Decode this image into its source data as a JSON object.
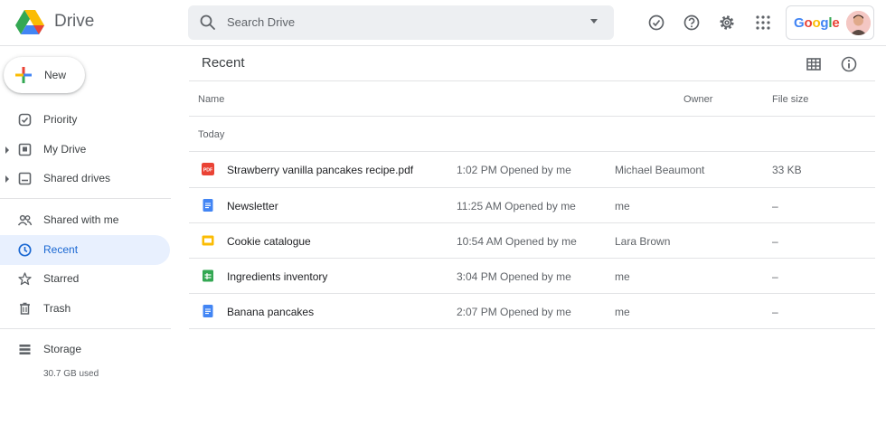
{
  "header": {
    "brand": "Drive",
    "search_placeholder": "Search Drive",
    "account_word": "Google"
  },
  "sidebar": {
    "new_label": "New",
    "items": [
      {
        "label": "Priority",
        "icon": "priority-icon"
      },
      {
        "label": "My Drive",
        "icon": "my-drive-icon"
      },
      {
        "label": "Shared drives",
        "icon": "shared-drives-icon"
      },
      {
        "label": "Shared with me",
        "icon": "shared-with-me-icon"
      },
      {
        "label": "Recent",
        "icon": "clock-icon"
      },
      {
        "label": "Starred",
        "icon": "star-icon"
      },
      {
        "label": "Trash",
        "icon": "trash-icon"
      },
      {
        "label": "Storage",
        "icon": "storage-icon"
      }
    ],
    "storage_used": "30.7 GB used"
  },
  "main": {
    "title": "Recent",
    "columns": {
      "name": "Name",
      "owner": "Owner",
      "size": "File size"
    },
    "section": "Today",
    "files": [
      {
        "name": "Strawberry vanilla pancakes recipe.pdf",
        "opened": "1:02 PM Opened by me",
        "owner": "Michael Beaumont",
        "size": "33 KB",
        "type": "pdf",
        "icon_label": "PDF"
      },
      {
        "name": "Newsletter",
        "opened": "11:25 AM Opened by me",
        "owner": "me",
        "size": "–",
        "type": "doc"
      },
      {
        "name": "Cookie catalogue",
        "opened": "10:54 AM Opened by me",
        "owner": "Lara Brown",
        "size": "–",
        "type": "slides"
      },
      {
        "name": "Ingredients inventory",
        "opened": "3:04 PM Opened by me",
        "owner": "me",
        "size": "–",
        "type": "sheet"
      },
      {
        "name": "Banana pancakes",
        "opened": "2:07 PM Opened by me",
        "owner": "me",
        "size": "–",
        "type": "doc"
      }
    ]
  },
  "colors": {
    "accent": "#1a73e8",
    "active_bg": "#e8f0fe",
    "pdf": "#ea4335",
    "doc": "#4285f4",
    "slides": "#fbbc04",
    "sheet": "#34a853"
  }
}
